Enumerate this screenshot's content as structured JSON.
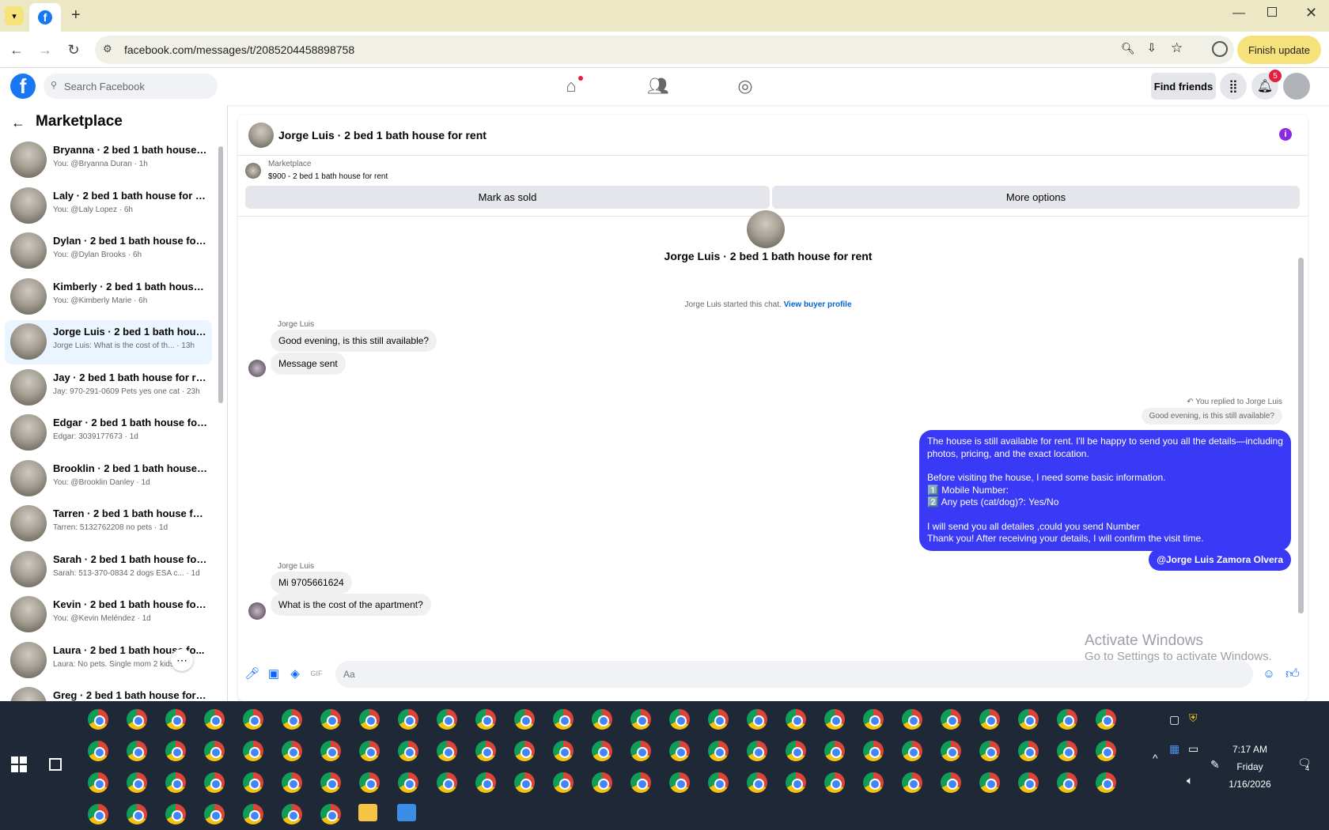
{
  "browser": {
    "url": "facebook.com/messages/t/2085204458898758",
    "finish_update": "Finish update"
  },
  "header": {
    "logo": "f",
    "search_placeholder": "Search Facebook",
    "find_friends": "Find friends",
    "notification_count": "5"
  },
  "sidebar": {
    "title": "Marketplace",
    "conversations": [
      {
        "name": "Bryanna · 2 bed 1 bath house fo...",
        "sub": "You: @Bryanna Duran · 1h"
      },
      {
        "name": "Laly · 2 bed 1 bath house for rent",
        "sub": "You: @Laly Lopez · 6h"
      },
      {
        "name": "Dylan · 2 bed 1 bath house for r...",
        "sub": "You: @Dylan Brooks · 6h"
      },
      {
        "name": "Kimberly · 2 bed 1 bath house f...",
        "sub": "You: @Kimberly Marie · 6h"
      },
      {
        "name": "Jorge Luis · 2 bed 1 bath house ...",
        "sub": "Jorge Luis: What is the cost of th... · 13h"
      },
      {
        "name": "Jay · 2 bed 1 bath house for rent",
        "sub": "Jay: 970-291-0609 Pets yes one cat · 23h"
      },
      {
        "name": "Edgar · 2 bed 1 bath house for r...",
        "sub": "Edgar: 3039177673 · 1d"
      },
      {
        "name": "Brooklin · 2 bed 1 bath house fo...",
        "sub": "You: @Brooklin Danley · 1d"
      },
      {
        "name": "Tarren · 2 bed 1 bath house for r...",
        "sub": "Tarren: 5132762208 no pets · 1d"
      },
      {
        "name": "Sarah · 2 bed 1 bath house for r...",
        "sub": "Sarah: 513-370-0834 2 dogs ESA c... · 1d"
      },
      {
        "name": "Kevin · 2 bed 1 bath house for r...",
        "sub": "You: @Kevin Meléndez · 1d"
      },
      {
        "name": "Laura · 2 bed 1 bath house fo...",
        "sub": "Laura: No pets. Single mom 2 kids · 1d"
      },
      {
        "name": "Greg · 2 bed 1 bath house for rent",
        "sub": ""
      }
    ]
  },
  "chat": {
    "title": "Jorge Luis · 2 bed 1 bath house for rent",
    "marketplace_label": "Marketplace",
    "listing": "$900 - 2 bed 1 bath house for rent",
    "mark_sold": "Mark as sold",
    "more_options": "More options",
    "started_text": "Jorge Luis started this chat.",
    "view_profile": "View buyer profile",
    "sender": "Jorge Luis",
    "msg1": "Good evening, is this still available?",
    "msg2": "Message sent",
    "replied_label": "You replied to Jorge Luis",
    "reply_quote": "Good evening, is this still available?",
    "out_lines": [
      "The house is still available for rent. I'll be happy to send you all the details—including photos, pricing, and the exact location.",
      "Before visiting the house, I need some basic information.",
      "1️⃣ Mobile Number:",
      "2️⃣ Any pets (cat/dog)?: Yes/No",
      "I will send you all detailes ,could you send Number",
      "Thank you! After receiving your details, I will confirm the visit time."
    ],
    "mention": "@Jorge Luis Zamora Olvera",
    "msg3": "Mi 9705661624",
    "msg4": "What is the cost of the apartment?",
    "input_placeholder": "Aa"
  },
  "watermark": {
    "line1": "Activate Windows",
    "line2": "Go to Settings to activate Windows."
  },
  "taskbar": {
    "time": "7:17 AM",
    "day": "Friday",
    "date": "1/16/2026",
    "notifications": "4"
  }
}
